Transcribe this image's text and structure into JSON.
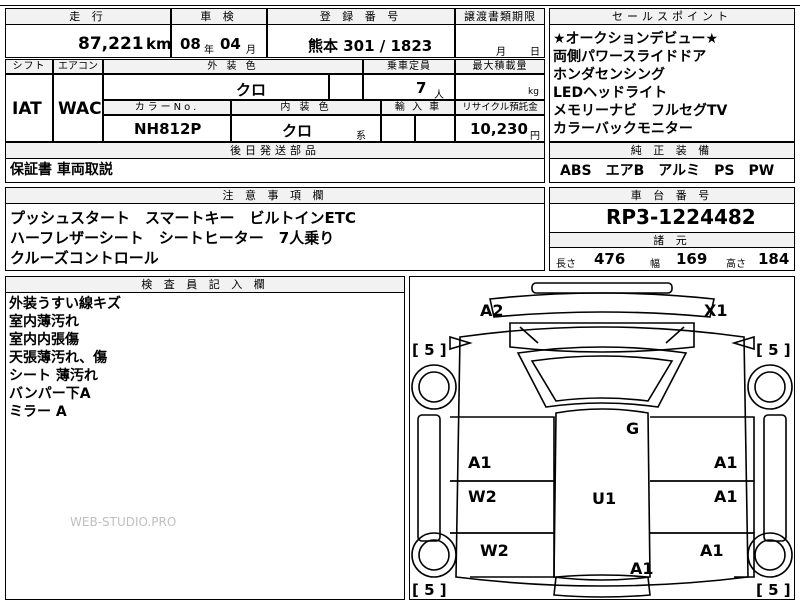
{
  "header": {
    "mileage_label": "走 行",
    "mileage_value": "87,221",
    "mileage_unit": "km",
    "inspection_label": "車 検",
    "inspection_year": "08",
    "inspection_year_unit": "年",
    "inspection_month": "04",
    "inspection_month_unit": "月",
    "registration_label": "登 録 番 号",
    "registration_value": "熊本 301 / 1823",
    "transfer_label": "譲渡書類期限",
    "transfer_month_unit": "月",
    "transfer_day_unit": "日"
  },
  "sales_points": {
    "title": "セールスポイント",
    "lines": [
      "★オークションデビュー★",
      "両側パワースライドドア",
      "ホンダセンシング",
      "LEDヘッドライト",
      "メモリーナビ　フルセグTV",
      "カラーバックモニター"
    ]
  },
  "row2": {
    "shift_label": "シフト",
    "shift_value": "IAT",
    "aircon_label": "エアコン",
    "aircon_value": "WAC",
    "exterior_label": "外 装 色",
    "exterior_value": "クロ",
    "capacity_label": "乗車定員",
    "capacity_value": "7",
    "capacity_unit": "人",
    "maxload_label": "最大積載量",
    "maxload_unit": "kg",
    "color_no_label": "カラーNo.",
    "color_no_value": "NH812P",
    "interior_label": "内 装 色",
    "interior_value": "クロ",
    "interior_unit": "系",
    "import_label": "輸 入 車",
    "recycle_label": "リサイクル預託金",
    "recycle_value": "10,230",
    "recycle_unit": "円"
  },
  "later_parts": {
    "label": "後日発送部品",
    "value": "保証書 車両取説"
  },
  "genuine": {
    "label": "純 正 装 備",
    "value": "ABS　エアB　アルミ　PS　PW"
  },
  "notes": {
    "label": "注 意 事 項 欄",
    "lines": [
      "プッシュスタート　スマートキー　ビルトインETC",
      "ハーフレザーシート　シートヒーター　7人乗り",
      "クルーズコントロール"
    ]
  },
  "chassis": {
    "label": "車 台 番 号",
    "value": "RP3-1224482"
  },
  "dimensions": {
    "label": "諸 元",
    "length_label": "長さ",
    "length_value": "476",
    "width_label": "幅",
    "width_value": "169",
    "height_label": "高さ",
    "height_value": "184"
  },
  "inspector": {
    "label": "検 査 員 記 入 欄",
    "lines": [
      "外装うすい線キズ",
      "室内薄汚れ",
      "室内内張傷",
      "天張薄汚れ、傷",
      "シート 薄汚れ",
      "バンパー下A",
      "ミラー A"
    ]
  },
  "diagram": {
    "codes": {
      "front_left": "A2",
      "front_right": "X1",
      "roof": "G",
      "left_front_door": "A1",
      "right_front_door": "A1",
      "left_rear_door": "W2",
      "right_rear_door": "A1",
      "interior": "U1",
      "left_rear_fender": "W2",
      "right_rear_fender": "A1",
      "rear": "A1"
    },
    "tires": {
      "front_left": "5",
      "front_right": "5",
      "rear_left": "5",
      "rear_right": "5"
    }
  },
  "watermark": "WEB-STUDIO.PRO"
}
